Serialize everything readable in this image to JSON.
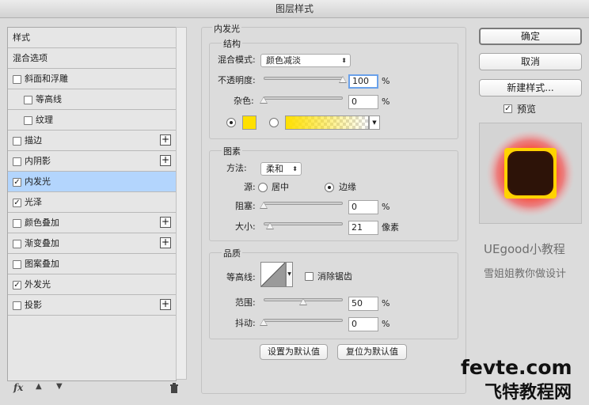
{
  "window": {
    "title": "图层样式"
  },
  "style_list": {
    "items": [
      {
        "label": "样式",
        "has_checkbox": false,
        "checked": false,
        "has_plus": false,
        "indent": 0,
        "selected": false
      },
      {
        "label": "混合选项",
        "has_checkbox": false,
        "checked": false,
        "has_plus": false,
        "indent": 0,
        "selected": false
      },
      {
        "label": "斜面和浮雕",
        "has_checkbox": true,
        "checked": false,
        "has_plus": false,
        "indent": 0,
        "selected": false
      },
      {
        "label": "等高线",
        "has_checkbox": true,
        "checked": false,
        "has_plus": false,
        "indent": 1,
        "selected": false
      },
      {
        "label": "纹理",
        "has_checkbox": true,
        "checked": false,
        "has_plus": false,
        "indent": 1,
        "selected": false
      },
      {
        "label": "描边",
        "has_checkbox": true,
        "checked": false,
        "has_plus": true,
        "indent": 0,
        "selected": false
      },
      {
        "label": "内阴影",
        "has_checkbox": true,
        "checked": false,
        "has_plus": true,
        "indent": 0,
        "selected": false
      },
      {
        "label": "内发光",
        "has_checkbox": true,
        "checked": true,
        "has_plus": false,
        "indent": 0,
        "selected": true
      },
      {
        "label": "光泽",
        "has_checkbox": true,
        "checked": true,
        "has_plus": false,
        "indent": 0,
        "selected": false
      },
      {
        "label": "颜色叠加",
        "has_checkbox": true,
        "checked": false,
        "has_plus": true,
        "indent": 0,
        "selected": false
      },
      {
        "label": "渐变叠加",
        "has_checkbox": true,
        "checked": false,
        "has_plus": true,
        "indent": 0,
        "selected": false
      },
      {
        "label": "图案叠加",
        "has_checkbox": true,
        "checked": false,
        "has_plus": false,
        "indent": 0,
        "selected": false
      },
      {
        "label": "外发光",
        "has_checkbox": true,
        "checked": true,
        "has_plus": false,
        "indent": 0,
        "selected": false
      },
      {
        "label": "投影",
        "has_checkbox": true,
        "checked": false,
        "has_plus": true,
        "indent": 0,
        "selected": false
      }
    ],
    "toolbar": {
      "fx_label": "fx",
      "up_icon": "▲",
      "down_icon": "▼",
      "trash_icon": "trash-icon"
    }
  },
  "panel": {
    "section_title": "内发光",
    "structure": {
      "title": "结构",
      "blend_mode_label": "混合模式:",
      "blend_mode_value": "颜色减淡",
      "opacity_label": "不透明度:",
      "opacity_value": "100",
      "opacity_percent": 100,
      "noise_label": "杂色:",
      "noise_value": "0",
      "noise_percent": 0,
      "percent_unit": "%",
      "glow_color": "#ffe000"
    },
    "elements": {
      "title": "图素",
      "method_label": "方法:",
      "method_value": "柔和",
      "source_label": "源:",
      "source_center": "居中",
      "source_edge": "边缘",
      "choke_label": "阻塞:",
      "choke_value": "0",
      "choke_percent": 0,
      "size_label": "大小:",
      "size_value": "21",
      "size_fraction": 0.084,
      "size_unit": "像素",
      "percent_unit": "%"
    },
    "quality": {
      "title": "品质",
      "contour_label": "等高线:",
      "anti_alias_label": "消除锯齿",
      "range_label": "范围:",
      "range_value": "50",
      "range_percent": 50,
      "jitter_label": "抖动:",
      "jitter_value": "0",
      "jitter_percent": 0,
      "percent_unit": "%"
    },
    "buttons": {
      "make_default": "设置为默认值",
      "reset_default": "复位为默认值"
    }
  },
  "actions": {
    "ok": "确定",
    "cancel": "取消",
    "new_style": "新建样式...",
    "preview_label": "预览",
    "preview_checked": true
  },
  "watermark": {
    "line1": "UEgood小教程",
    "line2": "雪姐姐教你做设计",
    "site": "fevte.com",
    "site_cn": "飞特教程网"
  },
  "colors": {
    "selection": "#b3d5fd",
    "accent_focus": "#6aa1ea",
    "glow_red": "#ff2200",
    "glow_yellow": "#ffe000"
  }
}
